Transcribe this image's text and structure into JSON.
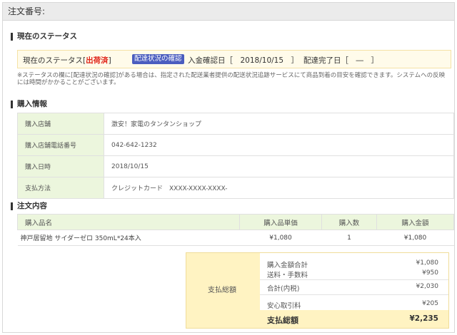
{
  "header": {
    "order_number_label": "注文番号:"
  },
  "status_section": {
    "title": "現在のステータス",
    "status_prefix": "現在のステータス[",
    "status_value": "出荷済",
    "status_suffix": "]",
    "confirm_button": "配達状況の確認",
    "payment_confirmed": "入金確認日［　2018/10/15　］",
    "delivery_completed": "配達完了日［　―　］",
    "note": "※ステータスの欄に[配達状況の確認]がある場合は、指定された配送業者提供の配送状況追跡サービスにて商品到着の目安を確認できます。システムへの反映には時間がかかることがございます。"
  },
  "purchase_info": {
    "title": "購入情報",
    "rows": [
      {
        "label": "購入店舗",
        "value": "激安！家電のタンタンショップ"
      },
      {
        "label": "購入店舗電話番号",
        "value": "042-642-1232"
      },
      {
        "label": "購入日時",
        "value": "2018/10/15"
      },
      {
        "label": "支払方法",
        "value": "クレジットカード　XXXX-XXXX-XXXX-"
      }
    ]
  },
  "order_contents": {
    "title": "注文内容",
    "columns": [
      "購入品名",
      "購入品単価",
      "購入数",
      "購入金額"
    ],
    "items": [
      {
        "name": "神戸居留地 サイダーゼロ 350mL*24本入",
        "unit_price": "¥1,080",
        "qty": "1",
        "amount": "¥1,080"
      }
    ]
  },
  "payment_summary": {
    "label": "支払総額",
    "subtotal_label": "購入金額合計",
    "subtotal": "¥1,080",
    "shipping_label": "送料・手数料",
    "shipping": "¥950",
    "total_tax_label": "合計(内税)",
    "total_tax": "¥2,030",
    "safety_fee_label": "安心取引料",
    "safety_fee": "¥205",
    "grand_total_label": "支払総額",
    "grand_total": "¥2,235"
  },
  "colors": {
    "status_value": "#e0261b",
    "button_bg": "#4b5dbf",
    "label_bg": "#ecf6dd",
    "summary_bg": "#fff3c2"
  }
}
